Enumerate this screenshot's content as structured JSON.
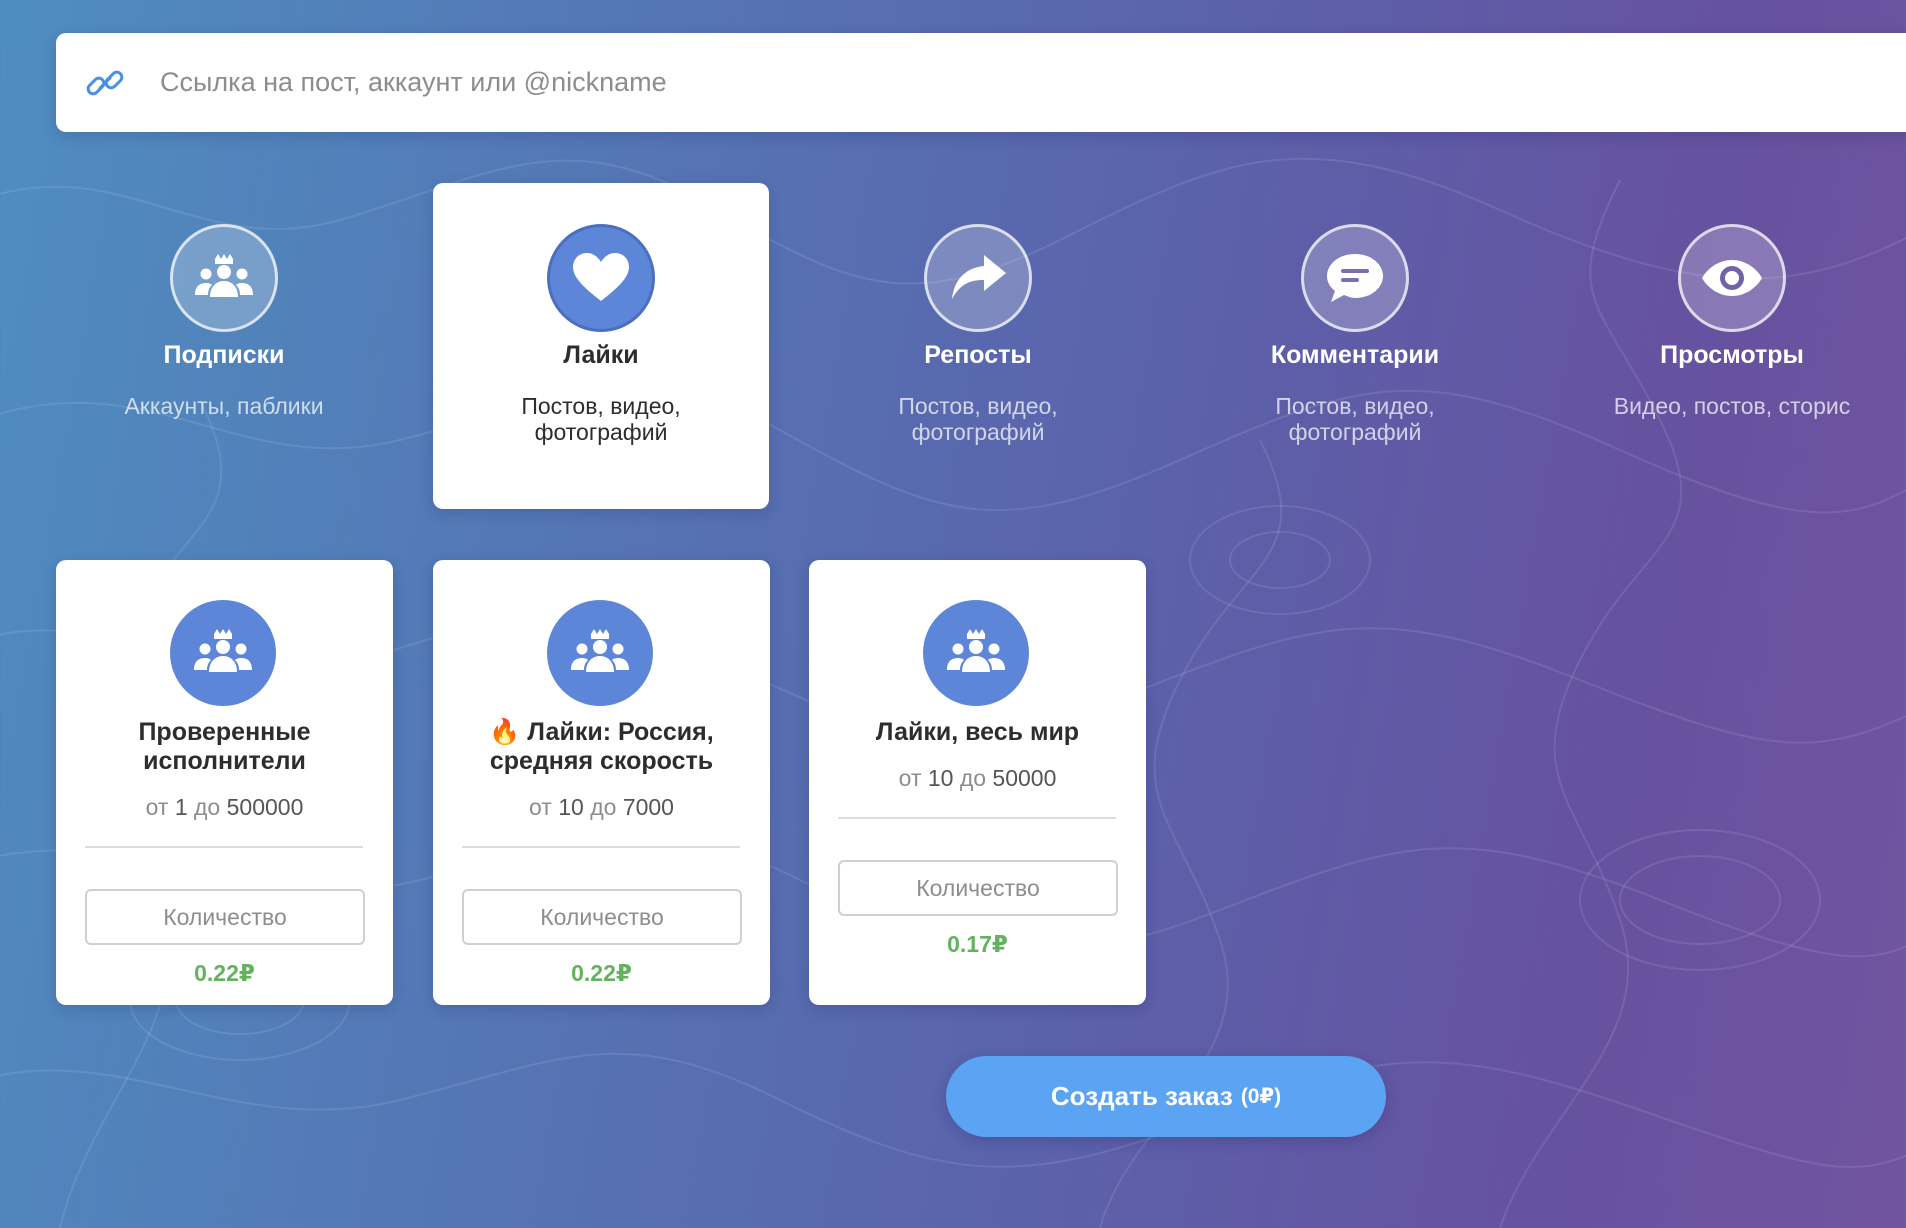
{
  "search": {
    "placeholder": "Ссылка на пост, аккаунт или @nickname"
  },
  "categories": [
    {
      "title": "Подписки",
      "subtitle": "Аккаунты, паблики",
      "icon": "users-icon",
      "active": false
    },
    {
      "title": "Лайки",
      "subtitle": "Постов, видео, фотографий",
      "icon": "heart-icon",
      "active": true
    },
    {
      "title": "Репосты",
      "subtitle": "Постов, видео, фотографий",
      "icon": "share-arrow-icon",
      "active": false
    },
    {
      "title": "Комментарии",
      "subtitle": "Постов, видео, фотографий",
      "icon": "comment-icon",
      "active": false
    },
    {
      "title": "Просмотры",
      "subtitle": "Видео, постов, сторис",
      "icon": "eye-icon",
      "active": false
    }
  ],
  "services": [
    {
      "title": "Проверенные исполнители",
      "from_label": "от",
      "min": "1",
      "to_label": "до",
      "max": "500000",
      "qty_placeholder": "Количество",
      "price": "0.22₽",
      "icon": "users-icon"
    },
    {
      "title": "🔥 Лайки: Россия, средняя скорость",
      "from_label": "от",
      "min": "10",
      "to_label": "до",
      "max": "7000",
      "qty_placeholder": "Количество",
      "price": "0.22₽",
      "icon": "users-icon"
    },
    {
      "title": "Лайки, весь мир",
      "from_label": "от",
      "min": "10",
      "to_label": "до",
      "max": "50000",
      "qty_placeholder": "Количество",
      "price": "0.17₽",
      "icon": "users-icon"
    }
  ],
  "order": {
    "label": "Создать заказ",
    "total": "(0₽)"
  },
  "colors": {
    "accent_blue": "#5d86d8",
    "button_blue": "#5ba4f3",
    "price_green": "#62b35e",
    "link_icon_blue": "#4a90e2"
  }
}
